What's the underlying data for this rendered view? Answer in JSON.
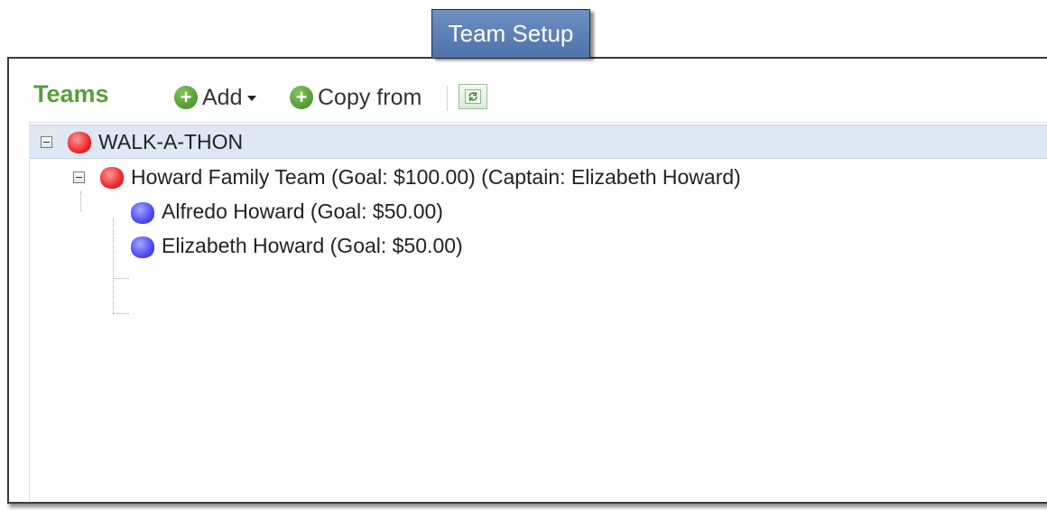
{
  "tab": {
    "label": "Team Setup"
  },
  "toolbar": {
    "title": "Teams",
    "add_label": "Add",
    "copy_from_label": "Copy from",
    "icons": {
      "add": "plus-circle-icon",
      "copy": "plus-circle-icon",
      "dropdown": "caret-down-icon",
      "refresh": "refresh-icon"
    }
  },
  "tree": {
    "root": {
      "label": "WALK-A-THON",
      "type": "event",
      "expanded": true,
      "selected": true
    },
    "team": {
      "label": "Howard Family Team (Goal: $100.00) (Captain: Elizabeth Howard)",
      "type": "team",
      "expanded": true
    },
    "members": [
      {
        "label": "Alfredo Howard (Goal: $50.00)",
        "type": "member"
      },
      {
        "label": "Elizabeth Howard (Goal: $50.00)",
        "type": "member"
      }
    ]
  },
  "colors": {
    "tab_background": "#5b7fb8",
    "title_green": "#5a9e3a",
    "selected_row": "#dfe7f3",
    "team_node": "#ee2a2a",
    "member_node": "#4d4df2"
  }
}
